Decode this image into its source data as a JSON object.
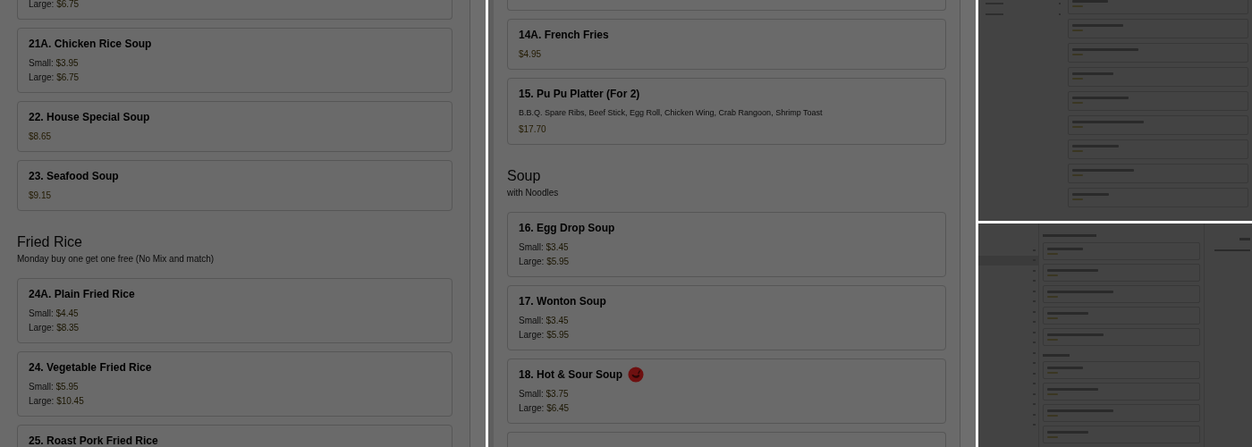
{
  "panels": [
    {
      "blocks": [
        {
          "kind": "card_end",
          "prices": [
            {
              "label": "Large:",
              "price": "$6.75"
            }
          ]
        },
        {
          "kind": "card",
          "title": "21A. Chicken Rice Soup",
          "prices": [
            {
              "label": "Small:",
              "price": "$3.95"
            },
            {
              "label": "Large:",
              "price": "$6.75"
            }
          ]
        },
        {
          "kind": "card",
          "title": "22. House Special Soup",
          "prices": [
            {
              "price": "$8.65"
            }
          ]
        },
        {
          "kind": "card",
          "title": "23. Seafood Soup",
          "prices": [
            {
              "price": "$9.15"
            }
          ]
        },
        {
          "kind": "heading",
          "title": "Fried Rice",
          "subtitle": "Monday buy one get one free (No Mix and match)"
        },
        {
          "kind": "card",
          "title": "24A. Plain Fried Rice",
          "prices": [
            {
              "label": "Small:",
              "price": "$4.45"
            },
            {
              "label": "Large:",
              "price": "$8.35"
            }
          ]
        },
        {
          "kind": "card",
          "title": "24. Vegetable Fried Rice",
          "prices": [
            {
              "label": "Small:",
              "price": "$5.95"
            },
            {
              "label": "Large:",
              "price": "$10.45"
            }
          ]
        },
        {
          "kind": "card",
          "title": "25. Roast Pork Fried Rice"
        }
      ]
    },
    {
      "blocks": [
        {
          "kind": "card_end"
        },
        {
          "kind": "card",
          "title": "14A. French Fries",
          "prices": [
            {
              "price": "$4.95"
            }
          ]
        },
        {
          "kind": "card",
          "title": "15. Pu Pu Platter (For 2)",
          "description": "B.B.Q. Spare Ribs, Beef Stick, Egg Roll, Chicken Wing, Crab Rangoon, Shrimp Toast",
          "prices": [
            {
              "price": "$17.70"
            }
          ]
        },
        {
          "kind": "heading",
          "title": "Soup",
          "subtitle": "with Noodles"
        },
        {
          "kind": "card",
          "title": "16. Egg Drop Soup",
          "prices": [
            {
              "label": "Small:",
              "price": "$3.45"
            },
            {
              "label": "Large:",
              "price": "$5.95"
            }
          ]
        },
        {
          "kind": "card",
          "title": "17. Wonton Soup",
          "prices": [
            {
              "label": "Small:",
              "price": "$3.45"
            },
            {
              "label": "Large:",
              "price": "$5.95"
            }
          ]
        },
        {
          "kind": "card",
          "title": "18. Hot & Sour Soup",
          "spicy": true,
          "prices": [
            {
              "label": "Small:",
              "price": "$3.75"
            },
            {
              "label": "Large:",
              "price": "$6.45"
            }
          ]
        },
        {
          "kind": "card_start"
        }
      ]
    }
  ]
}
